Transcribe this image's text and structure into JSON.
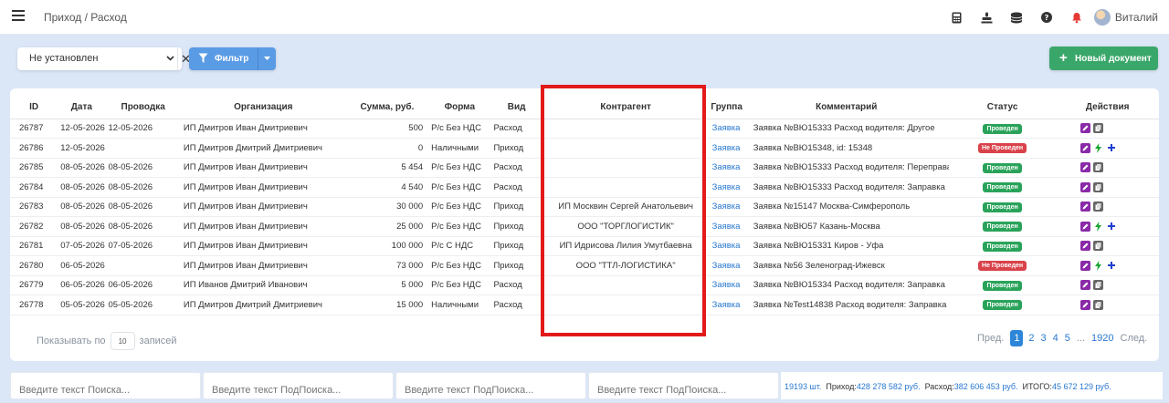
{
  "header": {
    "title": "Приход / Расход",
    "user_name": "Виталий",
    "icons": [
      "calculator-icon",
      "stamp-icon",
      "coins-icon",
      "help-icon",
      "bell-icon",
      "avatar"
    ]
  },
  "toolbar": {
    "select_value": "Не установлен",
    "filter_label": "Фильтр",
    "new_doc_label": "Новый документ"
  },
  "table": {
    "columns": [
      "ID",
      "Дата",
      "Проводка",
      "Организация",
      "Сумма, руб.",
      "Форма",
      "Вид",
      "Контрагент",
      "Группа",
      "Комментарий",
      "Статус",
      "Действия"
    ],
    "rows": [
      {
        "id": "26787",
        "date": "12-05-2026",
        "posting": "12-05-2026",
        "org": "ИП Дмитров Иван Дмитриевич",
        "sum": "500",
        "form": "Р/с Без НДС",
        "kind": "Расход",
        "contractor": "",
        "group": "Заявка",
        "comment": "Заявка №ВЮ15333 Расход водителя: Другое",
        "status": "Проведен",
        "status_type": "done",
        "actions": "edit-copy"
      },
      {
        "id": "26786",
        "date": "12-05-2026",
        "posting": "",
        "org": "ИП Дмитров Дмитрий Дмитриевич",
        "sum": "0",
        "form": "Наличными",
        "kind": "Приход",
        "contractor": "",
        "group": "Заявка",
        "comment": "Заявка №ВЮ15348, id: 15348",
        "status": "Не Проведен",
        "status_type": "notdone",
        "actions": "edit-exec-add"
      },
      {
        "id": "26785",
        "date": "08-05-2026",
        "posting": "08-05-2026",
        "org": "ИП Дмитров Иван Дмитриевич",
        "sum": "5 454",
        "form": "Р/с Без НДС",
        "kind": "Расход",
        "contractor": "",
        "group": "Заявка",
        "comment": "Заявка №ВЮ15333 Расход водителя: Переправа",
        "status": "Проведен",
        "status_type": "done",
        "actions": "edit-copy"
      },
      {
        "id": "26784",
        "date": "08-05-2026",
        "posting": "08-05-2026",
        "org": "ИП Дмитров Иван Дмитриевич",
        "sum": "4 540",
        "form": "Р/с Без НДС",
        "kind": "Расход",
        "contractor": "",
        "group": "Заявка",
        "comment": "Заявка №ВЮ15333 Расход водителя: Заправка",
        "status": "Проведен",
        "status_type": "done",
        "actions": "edit-copy"
      },
      {
        "id": "26783",
        "date": "08-05-2026",
        "posting": "08-05-2026",
        "org": "ИП Дмитров Иван Дмитриевич",
        "sum": "30 000",
        "form": "Р/с Без НДС",
        "kind": "Приход",
        "contractor": "ИП Москвин Сергей Анатольевич",
        "group": "Заявка",
        "comment": "Заявка №15147 Москва-Симферополь",
        "status": "Проведен",
        "status_type": "done",
        "actions": "edit-copy"
      },
      {
        "id": "26782",
        "date": "08-05-2026",
        "posting": "08-05-2026",
        "org": "ИП Дмитров Иван Дмитриевич",
        "sum": "25 000",
        "form": "Р/с Без НДС",
        "kind": "Приход",
        "contractor": "ООО \"ТОРГЛОГИСТИК\"",
        "group": "Заявка",
        "comment": "Заявка №ВЮ57 Казань-Москва",
        "status": "Проведен",
        "status_type": "done",
        "actions": "edit-exec-add"
      },
      {
        "id": "26781",
        "date": "07-05-2026",
        "posting": "07-05-2026",
        "org": "ИП Дмитров Иван Дмитриевич",
        "sum": "100 000",
        "form": "Р/с С НДС",
        "kind": "Приход",
        "contractor": "ИП Идрисова Лилия Умутбаевна",
        "group": "Заявка",
        "comment": "Заявка №ВЮ15331 Киров - Уфа",
        "status": "Проведен",
        "status_type": "done",
        "actions": "edit-copy"
      },
      {
        "id": "26780",
        "date": "06-05-2026",
        "posting": "",
        "org": "ИП Дмитров Иван Дмитриевич",
        "sum": "73 000",
        "form": "Р/с Без НДС",
        "kind": "Приход",
        "contractor": "ООО \"ТТЛ-ЛОГИСТИКА\"",
        "group": "Заявка",
        "comment": "Заявка №56 Зеленоград-Ижевск",
        "status": "Не Проведен",
        "status_type": "notdone",
        "actions": "edit-exec-add"
      },
      {
        "id": "26779",
        "date": "06-05-2026",
        "posting": "06-05-2026",
        "org": "ИП Иванов Дмитрий Иванович",
        "sum": "5 000",
        "form": "Р/с Без НДС",
        "kind": "Расход",
        "contractor": "",
        "group": "Заявка",
        "comment": "Заявка №ВЮ15334 Расход водителя: Заправка",
        "status": "Проведен",
        "status_type": "done",
        "actions": "edit-copy"
      },
      {
        "id": "26778",
        "date": "05-05-2026",
        "posting": "05-05-2026",
        "org": "ИП Дмитров Дмитрий Дмитриевич",
        "sum": "15 000",
        "form": "Наличными",
        "kind": "Расход",
        "contractor": "",
        "group": "Заявка",
        "comment": "Заявка №Test14838 Расход водителя: Заправка",
        "status": "Проведен",
        "status_type": "done",
        "actions": "edit-copy"
      }
    ]
  },
  "pager": {
    "show_label": "Показывать по",
    "page_size": "10",
    "records_label": "записей",
    "prev": "Пред.",
    "pages": [
      "1",
      "2",
      "3",
      "4",
      "5",
      "...",
      "1920"
    ],
    "current": "1",
    "next": "След."
  },
  "bottom": {
    "search_placeholder": "Введите текст Поиска...",
    "subsearch_placeholder": "Введите текст ПодПоиска...",
    "count_text": "19193 шт.",
    "income_label": "Приход:",
    "income_value": "428 278 582 руб.",
    "expense_label": "Расход:",
    "expense_value": "382 606 453 руб.",
    "total_label": "ИТОГО:",
    "total_value": "45 672 129 руб."
  },
  "colors": {
    "accent_blue": "#2878d0",
    "filter_button": "#5a9be5",
    "new_button": "#3aa76a",
    "status_done": "#2aa35a",
    "status_notdone": "#d9424a",
    "highlight_frame": "#e21a1a"
  }
}
